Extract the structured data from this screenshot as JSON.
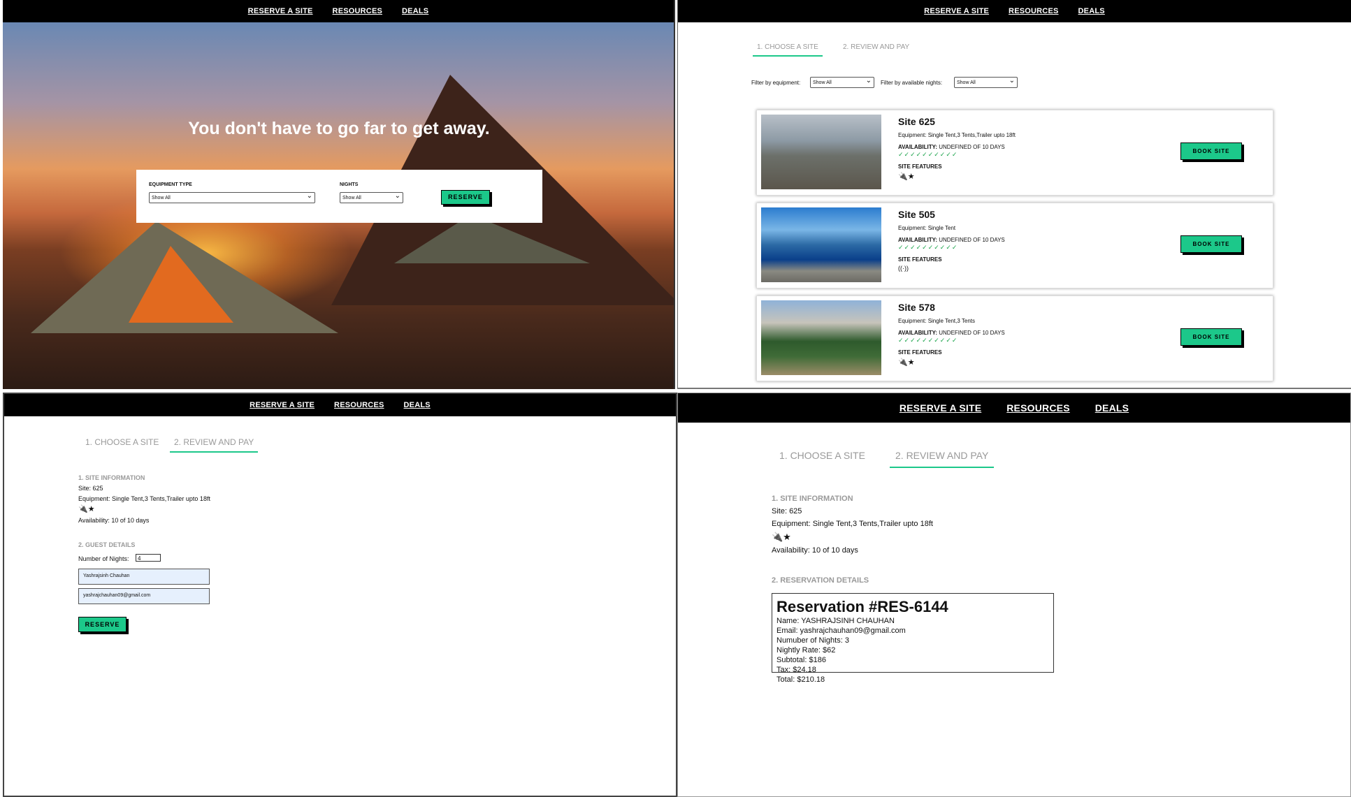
{
  "nav": {
    "items": [
      "RESERVE A SITE",
      "RESOURCES",
      "DEALS"
    ]
  },
  "hero": {
    "title": "You don't have to go far to get away.",
    "equipment_label": "EQUIPMENT TYPE",
    "equipment_value": "Show All",
    "nights_label": "NIGHTS",
    "nights_value": "Show All",
    "reserve_button": "RESERVE"
  },
  "tabs": {
    "choose": "1. CHOOSE A SITE",
    "review": "2. REVIEW AND PAY"
  },
  "filters": {
    "equipment_label": "Filter by equipment:",
    "equipment_value": "Show All",
    "nights_label": "Filter by available nights:",
    "nights_value": "Show All"
  },
  "sites": [
    {
      "title": "Site 625",
      "equipment": "Equipment: Single Tent,3 Tents,Trailer upto 18ft",
      "availability_label": "AVAILABILITY:",
      "availability_value": "UNDEFINED OF 10 DAYS",
      "checks": "✓✓✓✓✓✓✓✓✓✓",
      "features_label": "SITE FEATURES",
      "features_icons": "🔌★",
      "button": "BOOK SITE",
      "image": "bear"
    },
    {
      "title": "Site 505",
      "equipment": "Equipment: Single Tent",
      "availability_label": "AVAILABILITY:",
      "availability_value": "UNDEFINED OF 10 DAYS",
      "checks": "✓✓✓✓✓✓✓✓✓✓",
      "features_label": "SITE FEATURES",
      "features_icons": "((·))",
      "button": "BOOK SITE",
      "image": "fjord"
    },
    {
      "title": "Site 578",
      "equipment": "Equipment: Single Tent,3 Tents",
      "availability_label": "AVAILABILITY:",
      "availability_value": "UNDEFINED OF 10 DAYS",
      "checks": "✓✓✓✓✓✓✓✓✓✓",
      "features_label": "SITE FEATURES",
      "features_icons": "🔌★",
      "button": "BOOK SITE",
      "image": "yose"
    }
  ],
  "review_form": {
    "site_info_head": "1. SITE INFORMATION",
    "site": "Site: 625",
    "equipment": "Equipment: Single Tent,3 Tents,Trailer upto 18ft",
    "features_icons": "🔌★",
    "availability": "Availability: 10 of 10 days",
    "guest_head": "2. GUEST DETAILS",
    "nights_label": "Number of Nights:",
    "nights_value": "4",
    "name_value": "Yashrajsinh Chauhan",
    "email_value": "yashrajchauhan09@gmail.com",
    "reserve_button": "RESERVE"
  },
  "confirmation": {
    "site_info_head": "1. SITE INFORMATION",
    "site": "Site: 625",
    "equipment": "Equipment: Single Tent,3 Tents,Trailer upto 18ft",
    "features_icons": "🔌★",
    "availability": "Availability: 10 of 10 days",
    "reservation_head": "2. RESERVATION DETAILS",
    "reservation_title": "Reservation #RES-6144",
    "lines": [
      "Name:  YASHRAJSINH CHAUHAN",
      "Email:  yashrajchauhan09@gmail.com",
      "Numuber of Nights:  3",
      "Nightly Rate:  $62",
      "Subtotal:  $186",
      "Tax:  $24.18",
      "Total:  $210.18"
    ]
  },
  "colors": {
    "accent": "#1cc88a",
    "nav_bg": "#000000"
  }
}
